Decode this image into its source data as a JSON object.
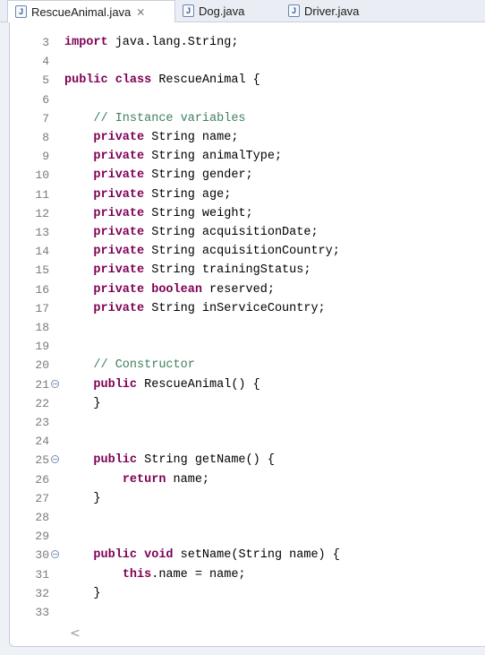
{
  "tabs": [
    {
      "label": "RescueAnimal.java",
      "active": true,
      "close": "⨯"
    },
    {
      "label": "Dog.java",
      "active": false
    },
    {
      "label": "Driver.java",
      "active": false
    }
  ],
  "icons": {
    "file": "java-file-icon",
    "fold": "fold-collapse-icon"
  },
  "colors": {
    "keyword": "#7f0055",
    "comment": "#3f7f5f",
    "line_number": "#7a7a7a"
  },
  "editor": {
    "lines": [
      {
        "n": "3",
        "text": "import java.lang.String;"
      },
      {
        "n": "4",
        "text": ""
      },
      {
        "n": "5",
        "text": "public class RescueAnimal {"
      },
      {
        "n": "6",
        "text": ""
      },
      {
        "n": "7",
        "text": "    // Instance variables"
      },
      {
        "n": "8",
        "text": "    private String name;"
      },
      {
        "n": "9",
        "text": "    private String animalType;"
      },
      {
        "n": "10",
        "text": "    private String gender;"
      },
      {
        "n": "11",
        "text": "    private String age;"
      },
      {
        "n": "12",
        "text": "    private String weight;"
      },
      {
        "n": "13",
        "text": "    private String acquisitionDate;"
      },
      {
        "n": "14",
        "text": "    private String acquisitionCountry;"
      },
      {
        "n": "15",
        "text": "    private String trainingStatus;"
      },
      {
        "n": "16",
        "text": "    private boolean reserved;"
      },
      {
        "n": "17",
        "text": "    private String inServiceCountry;"
      },
      {
        "n": "18",
        "text": ""
      },
      {
        "n": "19",
        "text": ""
      },
      {
        "n": "20",
        "text": "    // Constructor"
      },
      {
        "n": "21",
        "text": "    public RescueAnimal() {",
        "fold": true
      },
      {
        "n": "22",
        "text": "    }"
      },
      {
        "n": "23",
        "text": ""
      },
      {
        "n": "24",
        "text": ""
      },
      {
        "n": "25",
        "text": "    public String getName() {",
        "fold": true
      },
      {
        "n": "26",
        "text": "        return name;"
      },
      {
        "n": "27",
        "text": "    }"
      },
      {
        "n": "28",
        "text": ""
      },
      {
        "n": "29",
        "text": ""
      },
      {
        "n": "30",
        "text": "    public void setName(String name) {",
        "fold": true
      },
      {
        "n": "31",
        "text": "        this.name = name;"
      },
      {
        "n": "32",
        "text": "    }"
      },
      {
        "n": "33",
        "text": ""
      }
    ],
    "hscroll": "<"
  }
}
